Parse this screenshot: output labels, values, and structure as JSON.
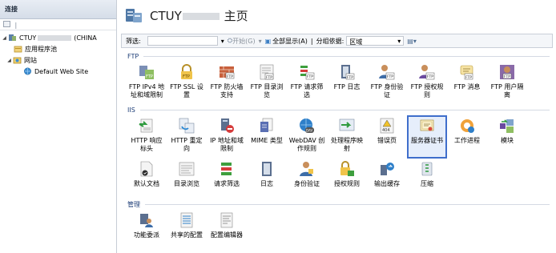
{
  "connections": {
    "header": "连接",
    "toolbar": "",
    "tree": [
      {
        "label": "CTUY",
        "suffix": "(CHINA",
        "level": 0,
        "icon": "server-icon"
      },
      {
        "label": "应用程序池",
        "level": 1,
        "icon": "app-pool-icon"
      },
      {
        "label": "网站",
        "level": 1,
        "icon": "sites-folder-icon"
      },
      {
        "label": "Default Web Site",
        "level": 2,
        "icon": "globe-icon"
      }
    ]
  },
  "main": {
    "title_prefix": "CTUY",
    "title_suffix": "主页"
  },
  "filter": {
    "label": "筛选:",
    "go": "开始(G)",
    "show_all": "全部显示(A)",
    "group_by": "分组依据:",
    "group_value": "区域"
  },
  "sections": {
    "ftp": {
      "title": "FTP",
      "items": [
        {
          "label": "FTP IPv4 地址和域限制",
          "icon": "ftp-ipv4-icon"
        },
        {
          "label": "FTP SSL 设置",
          "icon": "ftp-ssl-icon"
        },
        {
          "label": "FTP 防火墙支持",
          "icon": "ftp-firewall-icon"
        },
        {
          "label": "FTP 目录浏览",
          "icon": "ftp-directory-icon"
        },
        {
          "label": "FTP 请求筛选",
          "icon": "ftp-request-filter-icon"
        },
        {
          "label": "FTP 日志",
          "icon": "ftp-log-icon"
        },
        {
          "label": "FTP 身份验证",
          "icon": "ftp-auth-icon"
        },
        {
          "label": "FTP 授权规则",
          "icon": "ftp-authz-icon"
        },
        {
          "label": "FTP 消息",
          "icon": "ftp-message-icon"
        },
        {
          "label": "FTP 用户隔离",
          "icon": "ftp-user-isolation-icon"
        }
      ]
    },
    "iis": {
      "title": "IIS",
      "row1": [
        {
          "label": "HTTP 响应标头",
          "icon": "http-headers-icon"
        },
        {
          "label": "HTTP 重定向",
          "icon": "http-redirect-icon"
        },
        {
          "label": "IP 地址和域限制",
          "icon": "ip-restrict-icon"
        },
        {
          "label": "MIME 类型",
          "icon": "mime-icon"
        },
        {
          "label": "WebDAV 创作规则",
          "icon": "webdav-icon"
        },
        {
          "label": "处理程序映射",
          "icon": "handler-icon"
        },
        {
          "label": "错误页",
          "icon": "error-page-icon"
        },
        {
          "label": "服务器证书",
          "icon": "certificate-icon",
          "selected": true
        },
        {
          "label": "工作进程",
          "icon": "worker-process-icon"
        },
        {
          "label": "模块",
          "icon": "modules-icon"
        }
      ],
      "row2": [
        {
          "label": "默认文档",
          "icon": "default-doc-icon"
        },
        {
          "label": "目录浏览",
          "icon": "dir-browse-icon"
        },
        {
          "label": "请求筛选",
          "icon": "request-filter-icon"
        },
        {
          "label": "日志",
          "icon": "log-icon"
        },
        {
          "label": "身份验证",
          "icon": "auth-icon"
        },
        {
          "label": "授权规则",
          "icon": "authz-icon"
        },
        {
          "label": "输出缓存",
          "icon": "output-cache-icon"
        },
        {
          "label": "压缩",
          "icon": "compression-icon"
        }
      ]
    },
    "management": {
      "title": "管理",
      "items": [
        {
          "label": "功能委派",
          "icon": "feature-delegation-icon"
        },
        {
          "label": "共享的配置",
          "icon": "shared-config-icon"
        },
        {
          "label": "配置编辑器",
          "icon": "config-editor-icon"
        }
      ]
    }
  }
}
